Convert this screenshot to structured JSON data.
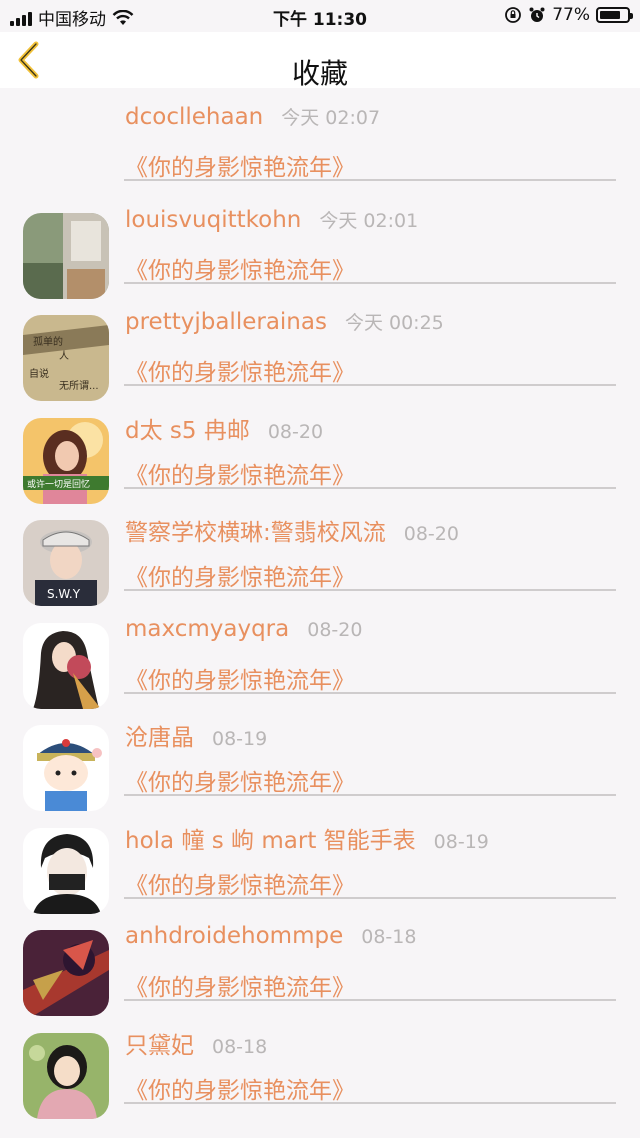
{
  "status_bar": {
    "carrier": "中国移动",
    "time": "下午 11:30",
    "battery_percent": "77%",
    "battery_level": 0.77
  },
  "nav": {
    "title": "收藏",
    "back_icon": "chevron-left-icon",
    "accent_color": "#f2c23a"
  },
  "items": [
    {
      "name": "dcocllehaan",
      "time": "今天 02:07",
      "book": "《你的身影惊艳流年》",
      "avatar_label": ""
    },
    {
      "name": "louisvuqittkohn",
      "time": "今天 02:01",
      "book": "《你的身影惊艳流年》",
      "avatar_label": ""
    },
    {
      "name": "prettyjballerainas",
      "time": "今天 00:25",
      "book": "《你的身影惊艳流年》",
      "avatar_label": "孤单的人 自说 无所谓..."
    },
    {
      "name": "d太 s5 冉邮",
      "time": "08-20",
      "book": "《你的身影惊艳流年》",
      "avatar_label": "或许一切是回忆"
    },
    {
      "name": "警察学校横琳:警翡校风流",
      "time": "08-20",
      "book": "《你的身影惊艳流年》",
      "avatar_label": "S.W.Y"
    },
    {
      "name": "maxcmyayqra",
      "time": "08-20",
      "book": "《你的身影惊艳流年》",
      "avatar_label": ""
    },
    {
      "name": "沧唐晶",
      "time": "08-19",
      "book": "《你的身影惊艳流年》",
      "avatar_label": ""
    },
    {
      "name": "hola 幢 s 岣 mart 智能手表",
      "time": "08-19",
      "book": "《你的身影惊艳流年》",
      "avatar_label": ""
    },
    {
      "name": "anhdroidehommpe",
      "time": "08-18",
      "book": "《你的身影惊艳流年》",
      "avatar_label": ""
    },
    {
      "name": "只黛妃",
      "time": "08-18",
      "book": "《你的身影惊艳流年》",
      "avatar_label": ""
    }
  ],
  "colors": {
    "name_text": "#e8905f",
    "time_text": "#b9b6b6",
    "background": "#f7f5f7"
  }
}
